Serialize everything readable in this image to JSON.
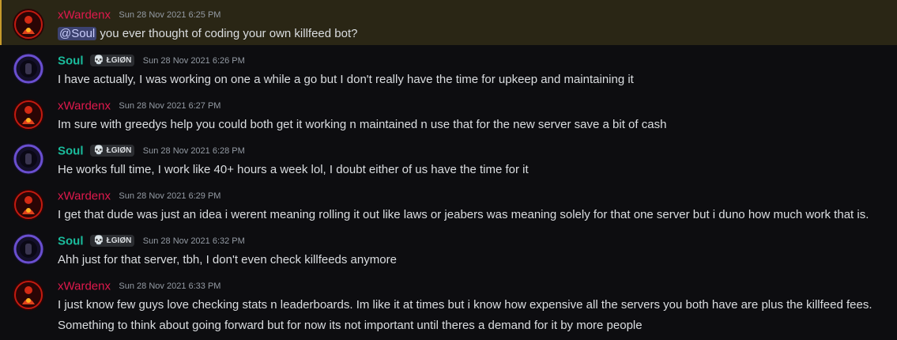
{
  "users": {
    "xwardenx": {
      "name": "xWardenx",
      "color": "#e0194d"
    },
    "soul": {
      "name": "Soul",
      "color": "#1abc9c",
      "tag": "ŁGIØN",
      "tag_icon": "skull-icon"
    }
  },
  "messages": [
    {
      "author": "xWardenx",
      "time": "Sun 28 Nov 2021 6:25 PM",
      "mention": "@Soul",
      "text": " you ever thought of coding your own killfeed bot?"
    },
    {
      "author": "Soul",
      "time": "Sun 28 Nov 2021 6:26 PM",
      "text": "I have actually, I was working on one a while a go but I don't really have the time for upkeep and maintaining it"
    },
    {
      "author": "xWardenx",
      "time": "Sun 28 Nov 2021 6:27 PM",
      "text": "Im sure with greedys help you could both get it working n maintained n use that for the new server save a bit of cash"
    },
    {
      "author": "Soul",
      "time": "Sun 28 Nov 2021 6:28 PM",
      "text": "He works full time, I work like 40+ hours a week lol, I doubt either of us have the time for it"
    },
    {
      "author": "xWardenx",
      "time": "Sun 28 Nov 2021 6:29 PM",
      "text": "I get that dude was just an idea i werent meaning rolling it out like laws or jeabers was meaning solely for that one server but i duno how much work that is."
    },
    {
      "author": "Soul",
      "time": "Sun 28 Nov 2021 6:32 PM",
      "text": "Ahh just for that server, tbh, I don't even check killfeeds anymore"
    },
    {
      "author": "xWardenx",
      "time": "Sun 28 Nov 2021 6:33 PM",
      "text": "I just know few guys love checking stats n leaderboards. Im like it at times but i know how expensive all the servers you both have are plus the killfeed fees.",
      "text2": "Something to think about going forward but for now its not important until theres a demand for it by more people"
    }
  ]
}
